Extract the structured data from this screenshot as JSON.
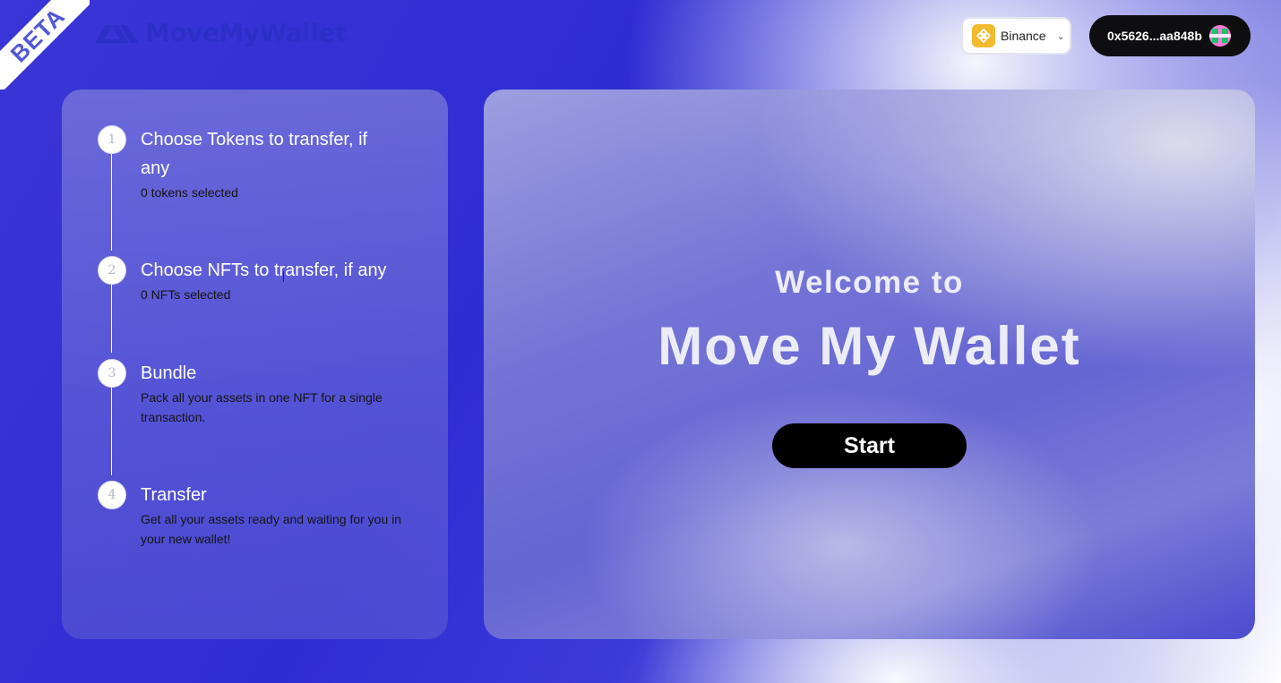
{
  "beta_ribbon": {
    "label": "BETA"
  },
  "header": {
    "logo_text": "MoveMyWallet",
    "network_select": {
      "label": "Binance",
      "icon": "binance-icon"
    },
    "wallet": {
      "address": "0x5626...aa848b",
      "avatar": "wallet-avatar"
    }
  },
  "steps": [
    {
      "number": "1",
      "title": "Choose Tokens to transfer, if any",
      "description": "0 tokens selected"
    },
    {
      "number": "2",
      "title": "Choose NFTs to transfer, if any",
      "description": "0 NFTs selected"
    },
    {
      "number": "3",
      "title": "Bundle",
      "description": "Pack all your assets in one NFT for a single transaction."
    },
    {
      "number": "4",
      "title": "Transfer",
      "description": "Get all your assets ready and waiting for you in your new wallet!"
    }
  ],
  "welcome": {
    "subtitle": "Welcome to",
    "title": "Move My Wallet",
    "start_label": "Start"
  },
  "colors": {
    "brand": "#2b2fc8",
    "background_blue": "#2e2dd3",
    "button_dark": "#0e0e10",
    "binance_yellow": "#f3ba2f"
  }
}
